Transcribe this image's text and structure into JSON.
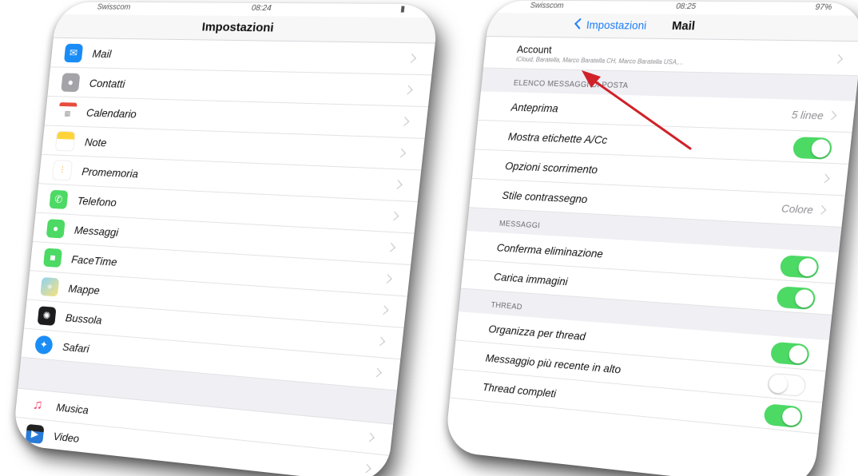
{
  "left_phone": {
    "status_carrier": "Swisscom",
    "status_time": "08:24",
    "title": "Impostazioni",
    "items": [
      {
        "label": "Mail",
        "icon": "mail-icon",
        "color": "#1a8cf5"
      },
      {
        "label": "Contatti",
        "icon": "contacts-icon",
        "color": "#9a9aa0"
      },
      {
        "label": "Calendario",
        "icon": "calendar-icon",
        "color": "#ffffff"
      },
      {
        "label": "Note",
        "icon": "notes-icon",
        "color": "#ffd43b"
      },
      {
        "label": "Promemoria",
        "icon": "reminders-icon",
        "color": "#ffffff"
      },
      {
        "label": "Telefono",
        "icon": "phone-icon",
        "color": "#4cd964"
      },
      {
        "label": "Messaggi",
        "icon": "messages-icon",
        "color": "#4cd964"
      },
      {
        "label": "FaceTime",
        "icon": "facetime-icon",
        "color": "#4cd964"
      },
      {
        "label": "Mappe",
        "icon": "maps-icon",
        "color": "#7ec8f0"
      },
      {
        "label": "Bussola",
        "icon": "compass-icon",
        "color": "#1c1c1e"
      },
      {
        "label": "Safari",
        "icon": "safari-icon",
        "color": "#1a8cf5"
      }
    ],
    "items2": [
      {
        "label": "Musica",
        "icon": "music-icon",
        "color": "#ffffff"
      },
      {
        "label": "Video",
        "icon": "video-icon",
        "color": "#2a7bd8"
      }
    ]
  },
  "right_phone": {
    "status_carrier": "Swisscom",
    "status_time": "08:25",
    "status_battery": "97%",
    "back_label": "Impostazioni",
    "title": "Mail",
    "account_label": "Account",
    "account_sub": "iCloud, Baratella, Marco Baratella CH, Marco Baratella USA,...",
    "section_1": "ELENCO MESSAGGI DI POSTA",
    "anteprima_label": "Anteprima",
    "anteprima_value": "5 linee",
    "etichette_label": "Mostra etichette A/Cc",
    "scorrimento_label": "Opzioni scorrimento",
    "contrassegno_label": "Stile contrassegno",
    "contrassegno_value": "Colore",
    "section_2": "MESSAGGI",
    "conferma_label": "Conferma eliminazione",
    "immagini_label": "Carica immagini",
    "section_3": "THREAD",
    "organizza_label": "Organizza per thread",
    "recente_label": "Messaggio più recente in alto",
    "completi_label": "Thread completi",
    "accent": "#4cd964",
    "arrow_color": "#d0212a"
  }
}
